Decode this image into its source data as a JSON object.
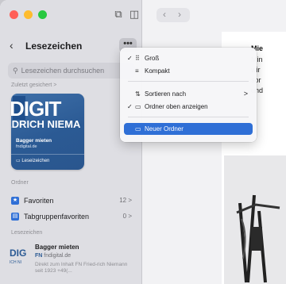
{
  "sidebar": {
    "title": "Lesezeichen",
    "more_label": "•••",
    "search_placeholder": "Lesezeichen durchsuchen",
    "recent_label": "Zuletzt gesichert >",
    "card": {
      "logo_line1": "DIGIT",
      "logo_line2": "EDRICH NIEMA",
      "title": "Bagger mieten",
      "subtitle": "fndigital.de",
      "reading_list": "Leseizeichen"
    },
    "folders_label": "Ordner",
    "folders": [
      {
        "label": "Favoriten",
        "count": "12 >"
      },
      {
        "label": "Tabgruppenfavoriten",
        "count": "0 >"
      }
    ],
    "bookmarks_label": "Lesezeichen",
    "bookmark": {
      "logo": "DIG",
      "logo_sub": "ICH NI",
      "title": "Bagger mieten",
      "domain_mark": "FN",
      "domain": "fndigital.de",
      "desc": "Direkt zum Inhalt FN Fried-rich Niemann seit 1923 +49(..."
    }
  },
  "menu": {
    "items": [
      {
        "check": "✓",
        "icon": "⠿",
        "label": "Groß"
      },
      {
        "check": "",
        "icon": "≡",
        "label": "Kompakt"
      },
      {
        "check": "",
        "icon": "⇅",
        "label": "Sortieren nach",
        "submenu": ">"
      },
      {
        "check": "✓",
        "icon": "▭",
        "label": "Ordner oben anzeigen"
      },
      {
        "check": "",
        "icon": "▭",
        "label": "Neuer Ordner"
      }
    ]
  },
  "page": {
    "heading": "Mie",
    "lines": [
      "Min",
      "wir",
      "sor",
      "und"
    ]
  },
  "colors": {
    "accent": "#2f6fd6",
    "brand": "#2b5a94"
  }
}
